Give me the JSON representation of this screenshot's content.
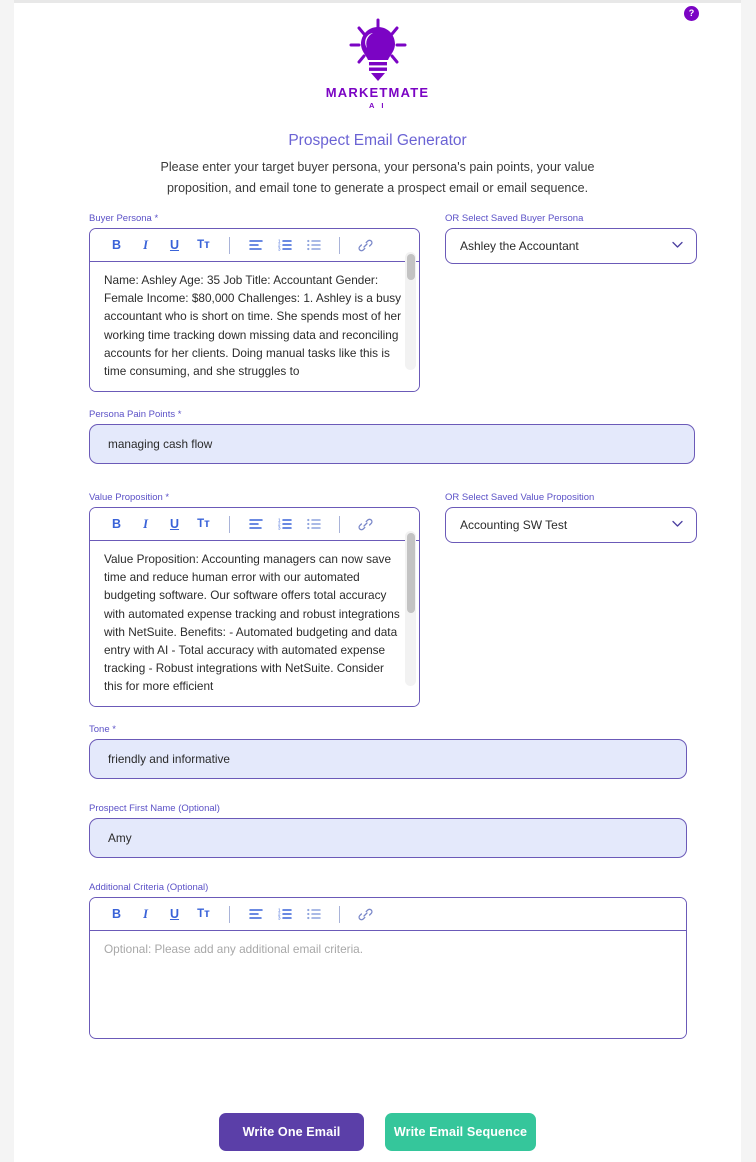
{
  "brand": {
    "name": "MARKETMATE",
    "sub": "A I",
    "logo_icon": "lightbulb-icon",
    "color": "#7b04c4"
  },
  "help": {
    "label": "?",
    "icon": "help-icon",
    "color": "#7b04c4"
  },
  "header": {
    "title": "Prospect Email Generator",
    "description": "Please enter your target buyer persona, your persona's pain points, your value proposition, and email tone to generate a prospect email or email sequence."
  },
  "toolbar": {
    "bold": "B",
    "italic": "I",
    "underline": "U",
    "clear_format": "Tᴛ",
    "align": "align-left-icon",
    "ordered_list": "ordered-list-icon",
    "bullet_list": "bullet-list-icon",
    "link": "link-icon"
  },
  "fields": {
    "buyer_persona": {
      "label": "Buyer Persona *",
      "value": "Name: Ashley  Age: 35  Job Title: Accountant  Gender: Female  Income: $80,000  Challenges:   1. Ashley is a busy accountant who is short on time. She spends most of her working time tracking down missing data and reconciling accounts for her clients. Doing manual tasks like this is time consuming, and she struggles to"
    },
    "saved_buyer_persona": {
      "label": "OR Select Saved Buyer Persona",
      "selected": "Ashley the Accountant"
    },
    "pain_points": {
      "label": "Persona Pain Points *",
      "value": "managing cash flow"
    },
    "value_proposition": {
      "label": "Value Proposition *",
      "value": "Value Proposition:   Accounting managers can now save time and reduce human error with our automated budgeting software. Our software offers total accuracy with automated expense tracking and robust integrations with NetSuite.   Benefits:  - Automated budgeting and data entry with AI - Total accuracy with automated expense tracking - Robust integrations with NetSuite.  Consider this for more efficient"
    },
    "saved_value_proposition": {
      "label": "OR Select Saved Value Proposition",
      "selected": "Accounting SW Test"
    },
    "tone": {
      "label": "Tone *",
      "value": "friendly and informative"
    },
    "prospect_first_name": {
      "label": "Prospect First Name (Optional)",
      "value": "Amy"
    },
    "additional_criteria": {
      "label": "Additional Criteria (Optional)",
      "placeholder": "Optional: Please add any additional email criteria.",
      "value": ""
    }
  },
  "actions": {
    "write_one_email": "Write One Email",
    "write_email_sequence": "Write Email Sequence",
    "primary_color": "#5b3fa8",
    "secondary_color": "#35c69b"
  }
}
